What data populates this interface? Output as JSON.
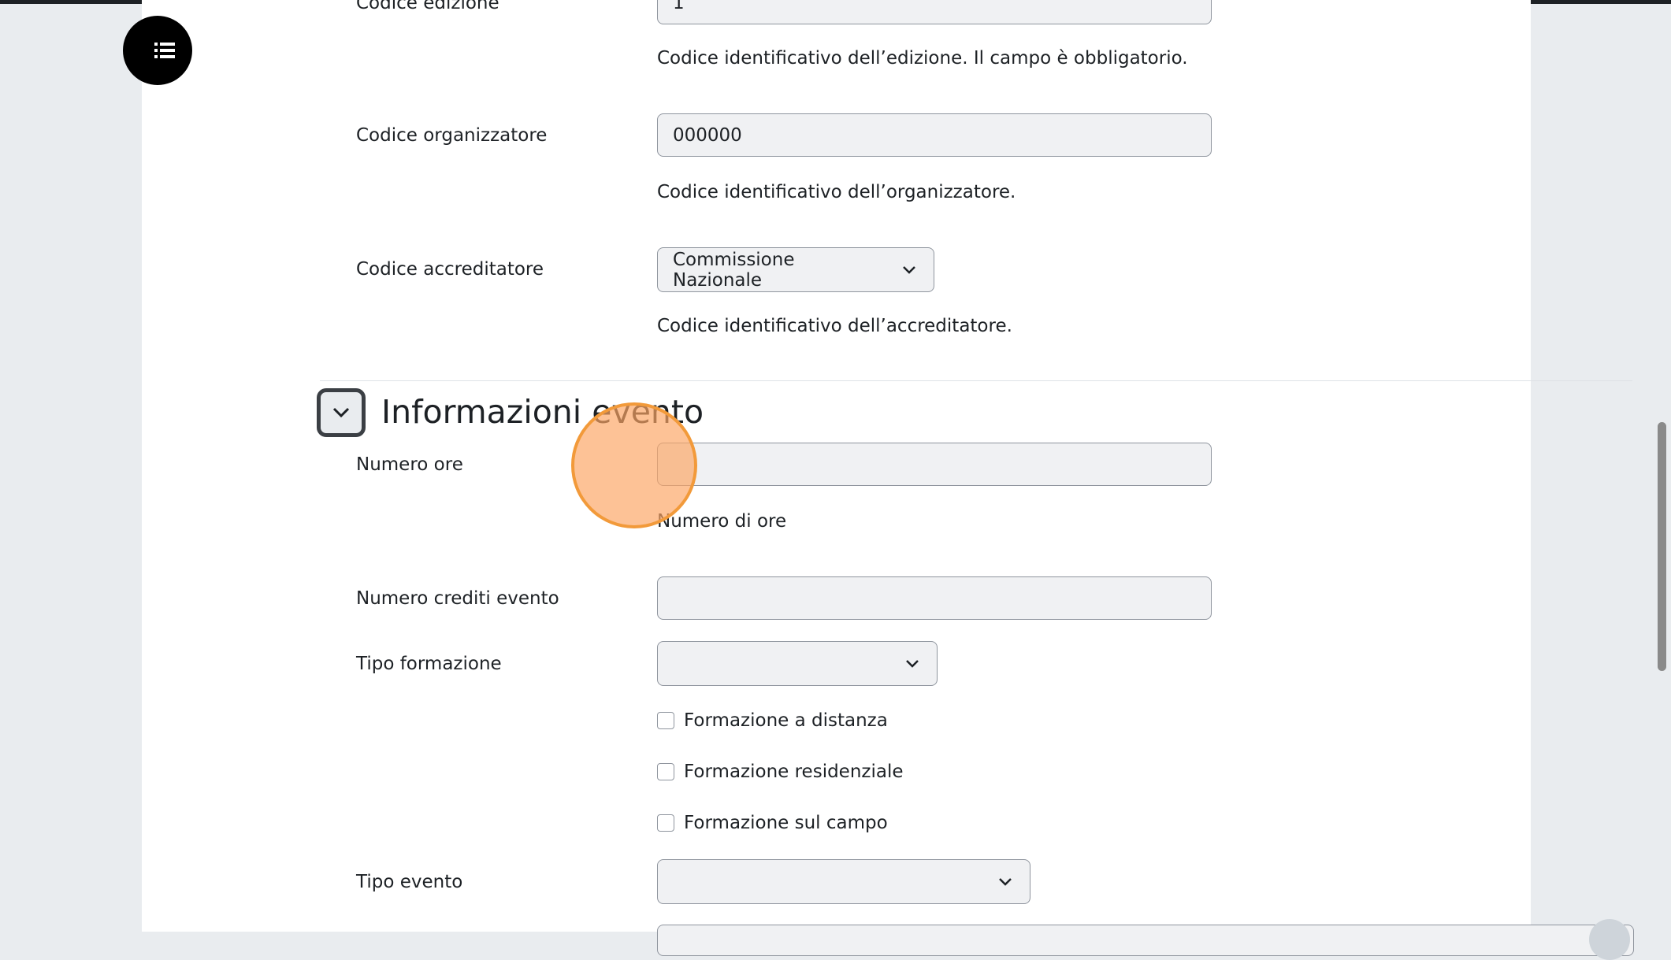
{
  "drawer": {
    "icon": "list-icon"
  },
  "fields": {
    "codice_edizione": {
      "label": "Codice edizione",
      "value": "1",
      "help": "Codice identificativo dell’edizione. Il campo è obbligatorio."
    },
    "codice_organizzatore": {
      "label": "Codice organizzatore",
      "value": "000000",
      "help": "Codice identificativo dell’organizzatore."
    },
    "codice_accreditatore": {
      "label": "Codice accreditatore",
      "selected": "Commissione Nazionale",
      "help": "Codice identificativo dell’accreditatore."
    }
  },
  "section": {
    "title": "Informazioni evento",
    "toggle_icon": "chevron-down-icon"
  },
  "evento": {
    "numero_ore": {
      "label": "Numero ore",
      "value": "",
      "help": "Numero di ore"
    },
    "numero_crediti": {
      "label": "Numero crediti evento",
      "value": ""
    },
    "tipo_formazione": {
      "label": "Tipo formazione",
      "selected": "",
      "options": [
        "Formazione a distanza",
        "Formazione residenziale",
        "Formazione sul campo"
      ]
    },
    "tipo_evento": {
      "label": "Tipo evento",
      "selected": ""
    }
  },
  "colors": {
    "accent": "#e84c3d",
    "cursor": "#f29a3a",
    "field_bg": "#f0f1f3"
  }
}
